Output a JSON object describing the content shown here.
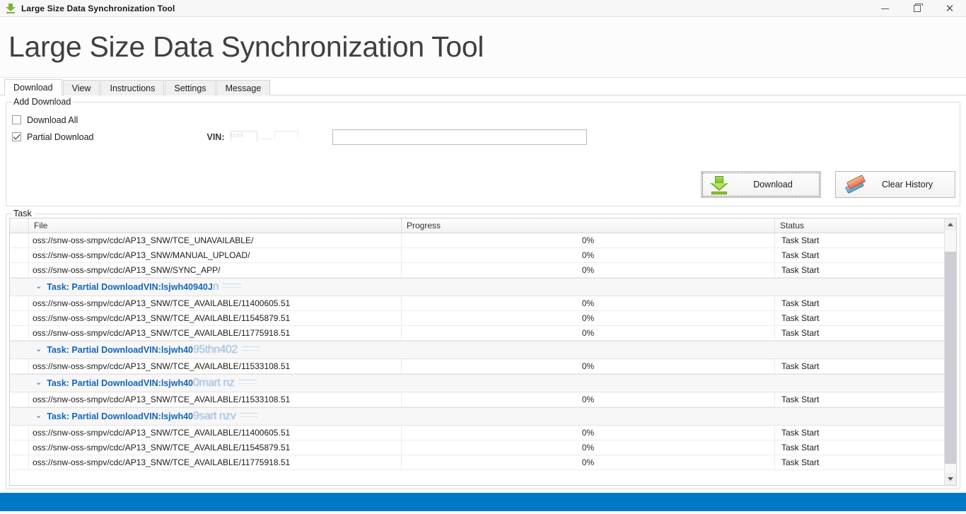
{
  "window": {
    "title": "Large Size Data Synchronization Tool",
    "icon": "download-arrow-icon",
    "minimize": "—",
    "maximize": "❐",
    "close": "✕"
  },
  "header": {
    "title": "Large Size Data Synchronization Tool"
  },
  "tabs": [
    {
      "label": "Download",
      "active": true
    },
    {
      "label": "View",
      "active": false
    },
    {
      "label": "Instructions",
      "active": false
    },
    {
      "label": "Settings",
      "active": false
    },
    {
      "label": "Message",
      "active": false
    }
  ],
  "add_download": {
    "legend": "Add Download",
    "download_all": {
      "label": "Download All",
      "checked": false
    },
    "partial_download": {
      "label": "Partial Download",
      "checked": true
    },
    "vin_label": "VIN:",
    "vin_value": "",
    "vin_placeholder": "",
    "ghost_text": "rc44",
    "download_button": "Download",
    "clear_history_button": "Clear History"
  },
  "task": {
    "legend": "Task",
    "columns": [
      "",
      "File",
      "Progress",
      "Status"
    ],
    "rows": [
      {
        "type": "file",
        "file": "oss://snw-oss-smpv/cdc/AP13_SNW/TCE_UNAVAILABLE/",
        "progress": "0%",
        "status": "Task Start"
      },
      {
        "type": "file",
        "file": "oss://snw-oss-smpv/cdc/AP13_SNW/MANUAL_UPLOAD/",
        "progress": "0%",
        "status": "Task Start"
      },
      {
        "type": "file",
        "file": "oss://snw-oss-smpv/cdc/AP13_SNW/SYNC_APP/",
        "progress": "0%",
        "status": "Task Start"
      },
      {
        "type": "group",
        "chevron": "⌄",
        "text": "Task: Partial DownloadVIN:lsjwh40940J",
        "fade": "n"
      },
      {
        "type": "file",
        "file": "oss://snw-oss-smpv/cdc/AP13_SNW/TCE_AVAILABLE/11400605.51",
        "progress": "0%",
        "status": "Task Start"
      },
      {
        "type": "file",
        "file": "oss://snw-oss-smpv/cdc/AP13_SNW/TCE_AVAILABLE/11545879.51",
        "progress": "0%",
        "status": "Task Start"
      },
      {
        "type": "file",
        "file": "oss://snw-oss-smpv/cdc/AP13_SNW/TCE_AVAILABLE/11775918.51",
        "progress": "0%",
        "status": "Task Start"
      },
      {
        "type": "group",
        "chevron": "⌄",
        "text": "Task: Partial DownloadVIN:lsjwh40",
        "fade": "95thn402"
      },
      {
        "type": "file",
        "file": "oss://snw-oss-smpv/cdc/AP13_SNW/TCE_AVAILABLE/11533108.51",
        "progress": "0%",
        "status": "Task Start"
      },
      {
        "type": "group",
        "chevron": "⌄",
        "text": "Task: Partial DownloadVIN:lsjwh40",
        "fade": "0mart nz"
      },
      {
        "type": "file",
        "file": "oss://snw-oss-smpv/cdc/AP13_SNW/TCE_AVAILABLE/11533108.51",
        "progress": "0%",
        "status": "Task Start"
      },
      {
        "type": "group",
        "chevron": "⌄",
        "text": "Task: Partial DownloadVIN:lsjwh40",
        "fade": "9sart nzv"
      },
      {
        "type": "file",
        "file": "oss://snw-oss-smpv/cdc/AP13_SNW/TCE_AVAILABLE/11400605.51",
        "progress": "0%",
        "status": "Task Start"
      },
      {
        "type": "file",
        "file": "oss://snw-oss-smpv/cdc/AP13_SNW/TCE_AVAILABLE/11545879.51",
        "progress": "0%",
        "status": "Task Start"
      },
      {
        "type": "file",
        "file": "oss://snw-oss-smpv/cdc/AP13_SNW/TCE_AVAILABLE/11775918.51",
        "progress": "0%",
        "status": "Task Start"
      }
    ]
  },
  "colors": {
    "accent_blue": "#1565c0",
    "taskbar": "#0078c8",
    "download_green": "#78bc1c"
  }
}
